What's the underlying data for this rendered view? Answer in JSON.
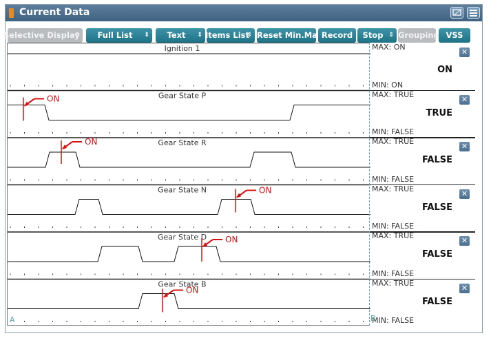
{
  "window": {
    "title": "Current Data"
  },
  "toolbar": {
    "selective_display": "Selective Display",
    "full_list": "Full List",
    "text": "Text",
    "items_list": "Items List",
    "reset_min_max": "Reset Min.Max",
    "record": "Record",
    "stop": "Stop",
    "grouping": "Grouping",
    "vss": "VSS"
  },
  "channels": [
    {
      "name": "Ignition 1",
      "max": "MAX: ON",
      "min": "MIN: ON",
      "value": "ON",
      "marker": ""
    },
    {
      "name": "Gear State P",
      "max": "MAX: TRUE",
      "min": "MIN: FALSE",
      "value": "TRUE",
      "marker": "ON"
    },
    {
      "name": "Gear State R",
      "max": "MAX: TRUE",
      "min": "MIN: FALSE",
      "value": "FALSE",
      "marker": "ON"
    },
    {
      "name": "Gear State N",
      "max": "MAX: TRUE",
      "min": "MIN: FALSE",
      "value": "FALSE",
      "marker": "ON"
    },
    {
      "name": "Gear State D",
      "max": "MAX: TRUE",
      "min": "MIN: FALSE",
      "value": "FALSE",
      "marker": "ON"
    },
    {
      "name": "Gear State B",
      "max": "MAX: TRUE",
      "min": "MIN: FALSE",
      "value": "FALSE",
      "marker": "ON"
    }
  ],
  "cursors": {
    "a": "A",
    "b": "B"
  },
  "colors": {
    "title_bar": "#4a6f90",
    "button": "#2a8195",
    "marker": "#d81010",
    "cursor": "#5aa7a8"
  }
}
